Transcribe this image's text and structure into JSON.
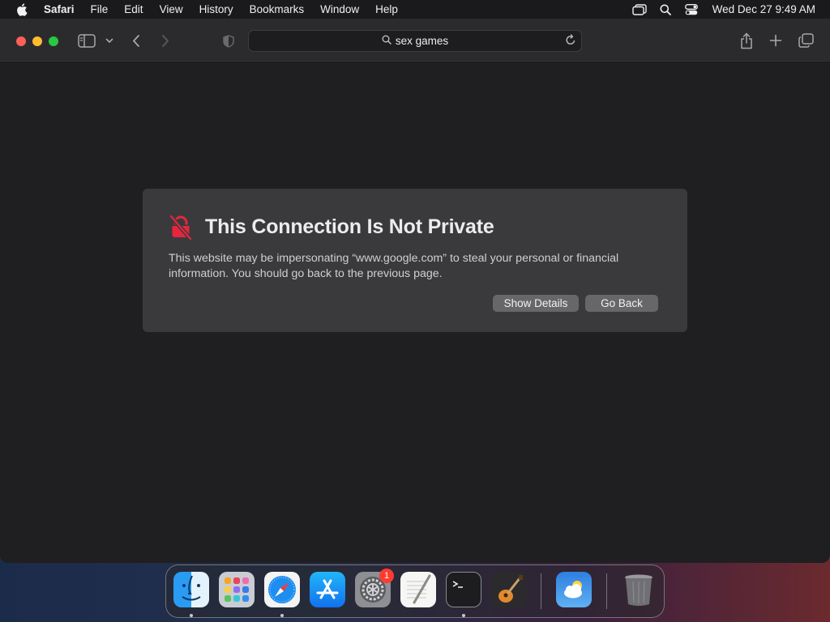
{
  "menubar": {
    "app_name": "Safari",
    "items": [
      "File",
      "Edit",
      "View",
      "History",
      "Bookmarks",
      "Window",
      "Help"
    ],
    "clock": "Wed Dec 27  9:49 AM"
  },
  "address_bar": {
    "query": "sex games"
  },
  "warning": {
    "title": "This Connection Is Not Private",
    "body": "This website may be impersonating “www.google.com” to steal your personal or financial information. You should go back to the previous page.",
    "show_details_label": "Show Details",
    "go_back_label": "Go Back",
    "icon_color": "#e5263e"
  },
  "dock": {
    "apps": [
      "finder-icon",
      "launchpad-icon",
      "safari-icon",
      "app-store-icon",
      "system-settings-icon",
      "textedit-icon",
      "terminal-icon",
      "garageband-icon",
      "weather-icon",
      "trash-icon"
    ],
    "settings_badge": "1"
  }
}
